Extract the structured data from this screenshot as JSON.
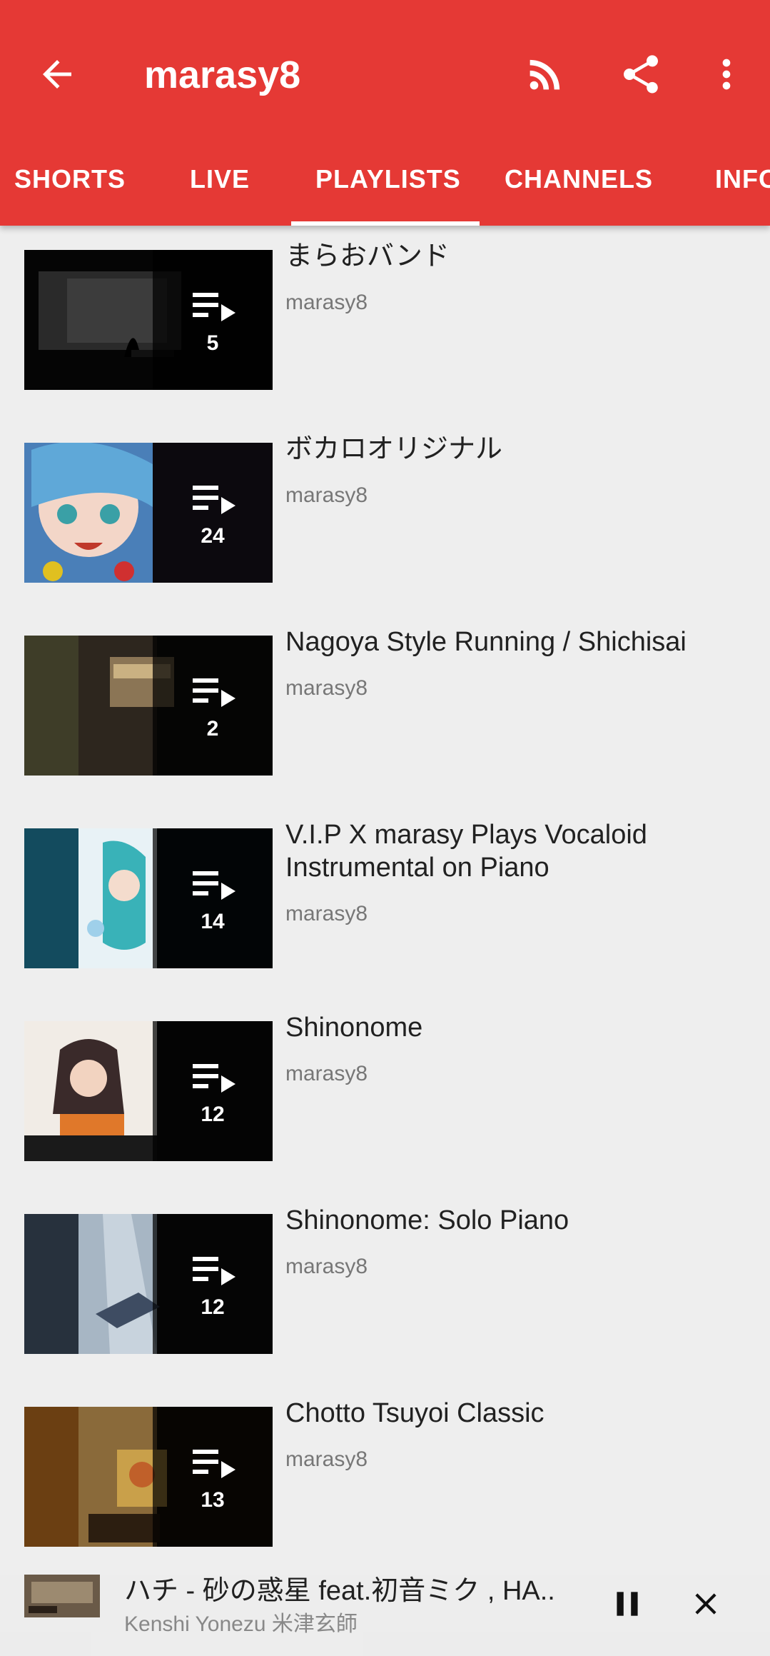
{
  "header": {
    "title": "marasy8",
    "back_icon": "arrow-back-icon",
    "actions": [
      "rss-icon",
      "share-icon",
      "more-vert-icon"
    ],
    "accent_color": "#e53935"
  },
  "tabs": [
    {
      "label": "SHORTS"
    },
    {
      "label": "LIVE"
    },
    {
      "label": "PLAYLISTS",
      "selected": true
    },
    {
      "label": "CHANNELS"
    },
    {
      "label": "INFO"
    }
  ],
  "playlists": [
    {
      "name": "まらおバンド",
      "uploader": "marasy8",
      "count": "5"
    },
    {
      "name": "ボカロオリジナル",
      "uploader": "marasy8",
      "count": "24"
    },
    {
      "name": "Nagoya Style Running / Shichisai",
      "uploader": "marasy8",
      "count": "2"
    },
    {
      "name": "V.I.P X marasy Plays Vocaloid Instrumental on Piano",
      "uploader": "marasy8",
      "count": "14"
    },
    {
      "name": "Shinonome",
      "uploader": "marasy8",
      "count": "12"
    },
    {
      "name": "Shinonome: Solo Piano",
      "uploader": "marasy8",
      "count": "12"
    },
    {
      "name": "Chotto Tsuyoi Classic",
      "uploader": "marasy8",
      "count": "13"
    }
  ],
  "player": {
    "track": "ハチ - 砂の惑星 feat.初音ミク , HA..",
    "artist": "Kenshi Yonezu  米津玄師",
    "pause_icon": "pause-icon",
    "close_icon": "close-icon"
  }
}
